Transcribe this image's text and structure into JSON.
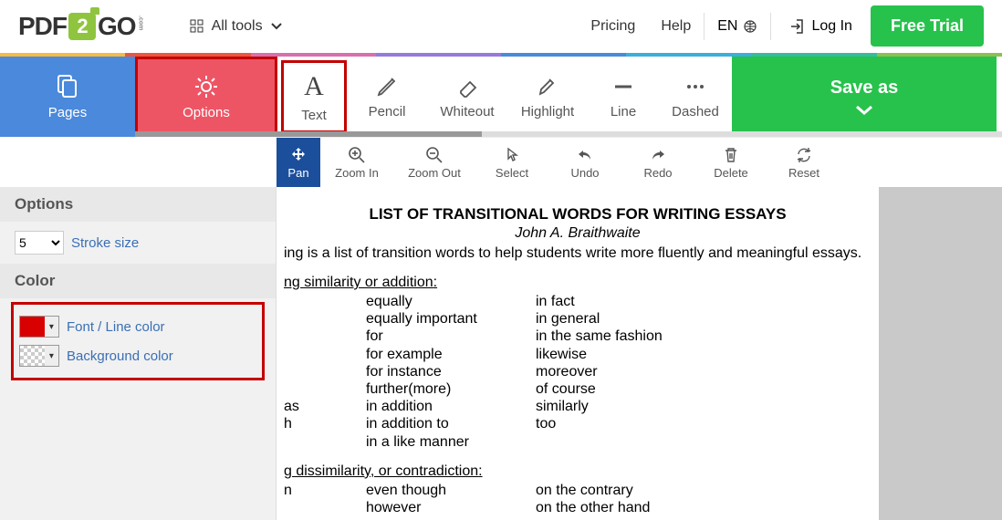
{
  "nav": {
    "logo_left": "PDF",
    "logo_num": "2",
    "logo_right": "GO",
    "all_tools": "All tools",
    "pricing": "Pricing",
    "help": "Help",
    "lang": "EN",
    "login": "Log In",
    "trial": "Free Trial"
  },
  "toolbar": {
    "pages": "Pages",
    "options": "Options",
    "text": "Text",
    "pencil": "Pencil",
    "whiteout": "Whiteout",
    "highlight": "Highlight",
    "line": "Line",
    "dashed": "Dashed",
    "saveas": "Save as"
  },
  "subtoolbar": {
    "pan": "Pan",
    "zoomin": "Zoom In",
    "zoomout": "Zoom Out",
    "select": "Select",
    "undo": "Undo",
    "redo": "Redo",
    "delete": "Delete",
    "reset": "Reset"
  },
  "sidebar": {
    "options_header": "Options",
    "stroke_value": "5",
    "stroke_label": "Stroke size",
    "color_header": "Color",
    "font_color_label": "Font / Line color",
    "font_color_hex": "#d80000",
    "bg_color_label": "Background color",
    "bg_color_hex": "transparent"
  },
  "document": {
    "title": "LIST OF TRANSITIONAL WORDS FOR WRITING ESSAYS",
    "author": "John A. Braithwaite",
    "intro": "ing is a list of transition words to help students write more fluently and meaningful essays.",
    "sect1": "ng similarity or addition",
    "sect1_col1": [
      "",
      "",
      "",
      "",
      "",
      "",
      "     as",
      "h",
      ""
    ],
    "sect1_col2": [
      "equally",
      "equally important",
      "for",
      "for example",
      "for instance",
      "further(more)",
      "in addition",
      "in addition to",
      "in a like manner"
    ],
    "sect1_col3": [
      "in fact",
      "in general",
      "in the same fashion",
      "likewise",
      "moreover",
      "of course",
      "similarly",
      "too",
      ""
    ],
    "sect2": "g dissimilarity, or contradiction",
    "sect2_col1": [
      "n",
      ""
    ],
    "sect2_col2": [
      "even though",
      "however"
    ],
    "sect2_col3": [
      "on the contrary",
      "on the other hand"
    ]
  }
}
